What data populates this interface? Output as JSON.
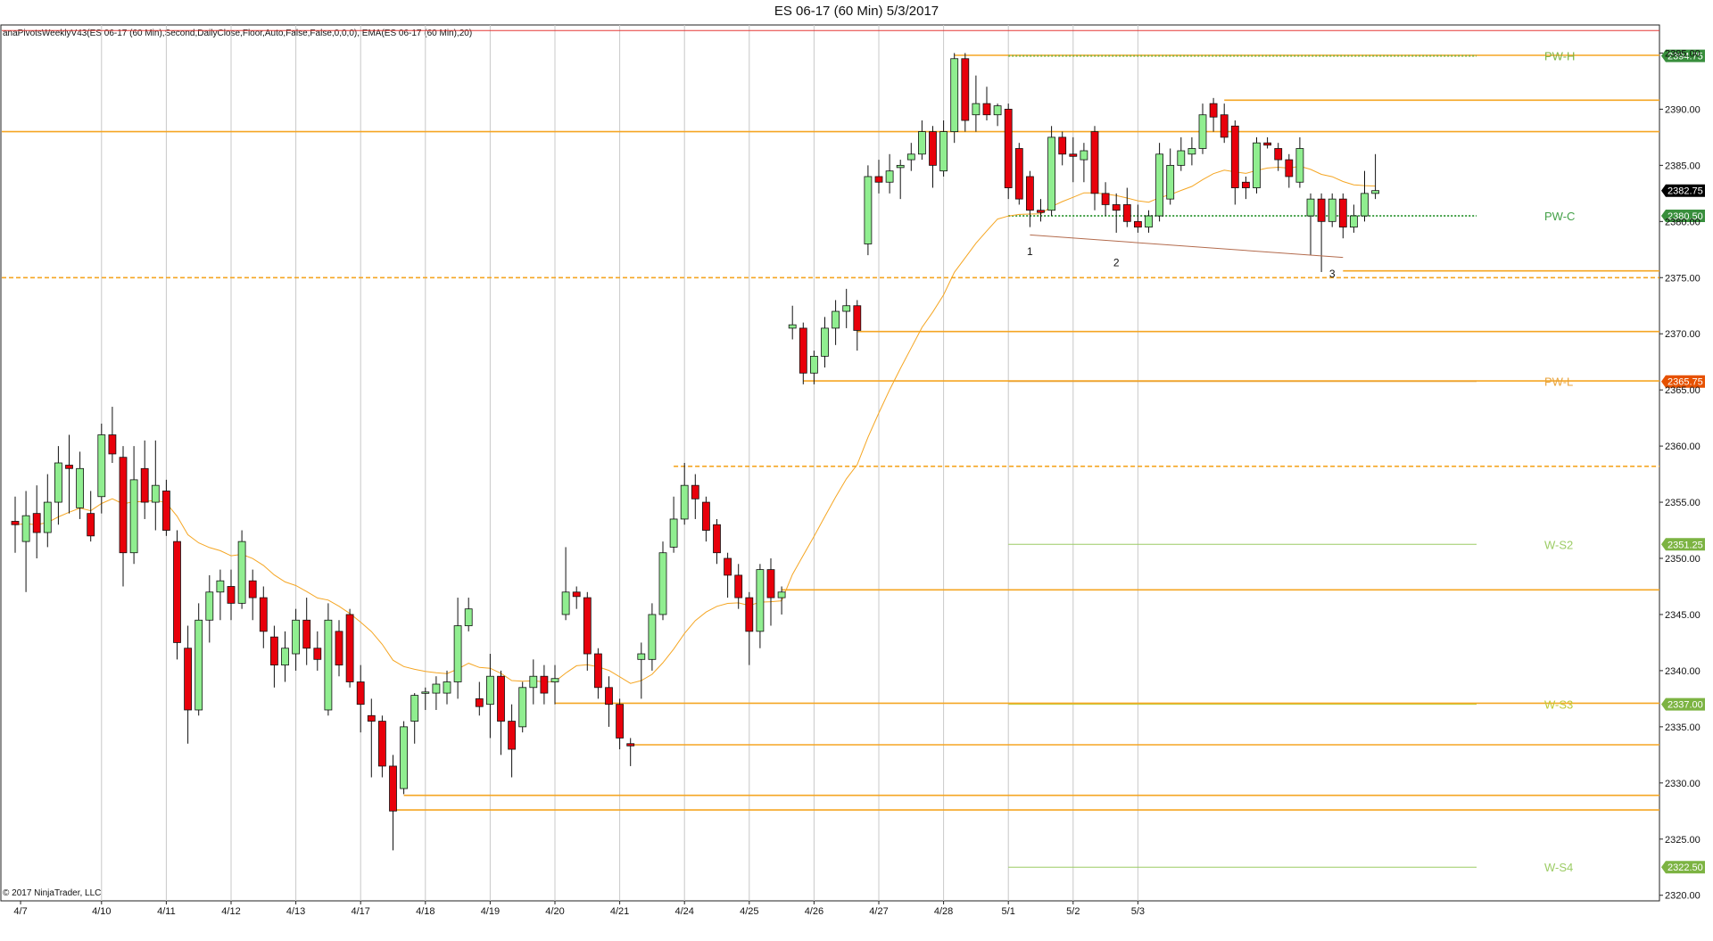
{
  "chart_data": {
    "type": "candlestick",
    "title": "ES 06-17 (60 Min)  5/3/2017",
    "indicator_label": "anaPivotsWeeklyV43(ES 06-17 (60 Min),Second,DailyClose,Floor,Auto,False,False,0,0,0), EMA(ES 06-17 (60 Min),20)",
    "copyright": "© 2017 NinjaTrader, LLC",
    "ylim": [
      2319.5,
      2397.5
    ],
    "y_ticks": [
      "2320.00",
      "2325.00",
      "2330.00",
      "2335.00",
      "2340.00",
      "2345.00",
      "2350.00",
      "2355.00",
      "2360.00",
      "2365.00",
      "2370.00",
      "2375.00",
      "2380.00",
      "2385.00",
      "2390.00",
      "2395.00"
    ],
    "x_day_labels": [
      "4/7",
      "4/10",
      "4/11",
      "4/12",
      "4/13",
      "4/17",
      "4/18",
      "4/19",
      "4/20",
      "4/21",
      "4/24",
      "4/25",
      "4/26",
      "4/27",
      "4/28",
      "5/1",
      "5/2",
      "5/3"
    ],
    "x_day_bar_index": [
      0.5,
      8,
      14,
      20,
      26,
      32,
      38,
      44,
      50,
      56,
      62,
      68,
      74,
      80,
      86,
      92,
      98,
      104
    ],
    "candles": [
      {
        "o": 2353.3,
        "h": 2355.5,
        "l": 2350.5,
        "c": 2353.0
      },
      {
        "o": 2351.5,
        "h": 2356.0,
        "l": 2347.0,
        "c": 2353.8
      },
      {
        "o": 2354.0,
        "h": 2356.5,
        "l": 2350.0,
        "c": 2352.3
      },
      {
        "o": 2352.3,
        "h": 2357.5,
        "l": 2351.0,
        "c": 2355.0
      },
      {
        "o": 2355.0,
        "h": 2360.0,
        "l": 2353.0,
        "c": 2358.5
      },
      {
        "o": 2358.3,
        "h": 2361.0,
        "l": 2354.0,
        "c": 2358.0
      },
      {
        "o": 2354.5,
        "h": 2359.5,
        "l": 2353.5,
        "c": 2358.0
      },
      {
        "o": 2354.0,
        "h": 2356.0,
        "l": 2351.5,
        "c": 2352.0
      },
      {
        "o": 2355.5,
        "h": 2362.0,
        "l": 2354.0,
        "c": 2361.0
      },
      {
        "o": 2361.0,
        "h": 2363.5,
        "l": 2358.5,
        "c": 2359.3
      },
      {
        "o": 2359.0,
        "h": 2360.0,
        "l": 2347.5,
        "c": 2350.5
      },
      {
        "o": 2350.5,
        "h": 2360.0,
        "l": 2349.5,
        "c": 2357.0
      },
      {
        "o": 2358.0,
        "h": 2360.5,
        "l": 2353.5,
        "c": 2355.0
      },
      {
        "o": 2355.0,
        "h": 2360.5,
        "l": 2352.5,
        "c": 2356.5
      },
      {
        "o": 2356.0,
        "h": 2357.0,
        "l": 2352.0,
        "c": 2352.5
      },
      {
        "o": 2351.5,
        "h": 2352.5,
        "l": 2341.0,
        "c": 2342.5
      },
      {
        "o": 2342.0,
        "h": 2344.0,
        "l": 2333.5,
        "c": 2336.5
      },
      {
        "o": 2336.5,
        "h": 2346.0,
        "l": 2336.0,
        "c": 2344.5
      },
      {
        "o": 2344.5,
        "h": 2348.5,
        "l": 2342.5,
        "c": 2347.0
      },
      {
        "o": 2347.0,
        "h": 2349.0,
        "l": 2344.5,
        "c": 2348.0
      },
      {
        "o": 2347.5,
        "h": 2349.0,
        "l": 2344.5,
        "c": 2346.0
      },
      {
        "o": 2346.0,
        "h": 2352.5,
        "l": 2345.5,
        "c": 2351.5
      },
      {
        "o": 2348.0,
        "h": 2349.0,
        "l": 2344.5,
        "c": 2346.5
      },
      {
        "o": 2346.5,
        "h": 2347.5,
        "l": 2342.0,
        "c": 2343.5
      },
      {
        "o": 2343.0,
        "h": 2344.0,
        "l": 2338.5,
        "c": 2340.5
      },
      {
        "o": 2340.5,
        "h": 2343.5,
        "l": 2339.0,
        "c": 2342.0
      },
      {
        "o": 2341.5,
        "h": 2345.5,
        "l": 2340.0,
        "c": 2344.5
      },
      {
        "o": 2344.5,
        "h": 2346.5,
        "l": 2340.5,
        "c": 2342.0
      },
      {
        "o": 2342.0,
        "h": 2343.5,
        "l": 2340.0,
        "c": 2341.0
      },
      {
        "o": 2336.5,
        "h": 2346.0,
        "l": 2336.0,
        "c": 2344.5
      },
      {
        "o": 2343.5,
        "h": 2344.5,
        "l": 2339.5,
        "c": 2340.5
      },
      {
        "o": 2345.0,
        "h": 2345.5,
        "l": 2338.5,
        "c": 2339.0
      },
      {
        "o": 2339.0,
        "h": 2340.5,
        "l": 2334.5,
        "c": 2337.0
      },
      {
        "o": 2336.0,
        "h": 2337.5,
        "l": 2330.5,
        "c": 2335.5
      },
      {
        "o": 2335.5,
        "h": 2336.0,
        "l": 2330.5,
        "c": 2331.5
      },
      {
        "o": 2331.5,
        "h": 2332.5,
        "l": 2324.0,
        "c": 2327.5
      },
      {
        "o": 2329.5,
        "h": 2335.5,
        "l": 2329.0,
        "c": 2335.0
      },
      {
        "o": 2335.5,
        "h": 2338.0,
        "l": 2333.5,
        "c": 2337.8
      },
      {
        "o": 2338.0,
        "h": 2338.5,
        "l": 2336.5,
        "c": 2338.1
      },
      {
        "o": 2338.0,
        "h": 2339.5,
        "l": 2336.5,
        "c": 2338.8
      },
      {
        "o": 2338.0,
        "h": 2340.0,
        "l": 2337.0,
        "c": 2339.0
      },
      {
        "o": 2339.0,
        "h": 2346.5,
        "l": 2337.5,
        "c": 2344.0
      },
      {
        "o": 2344.0,
        "h": 2346.5,
        "l": 2343.5,
        "c": 2345.5
      },
      {
        "o": 2337.5,
        "h": 2339.0,
        "l": 2336.0,
        "c": 2336.8
      },
      {
        "o": 2337.0,
        "h": 2341.5,
        "l": 2334.0,
        "c": 2339.5
      },
      {
        "o": 2339.5,
        "h": 2340.0,
        "l": 2332.5,
        "c": 2335.5
      },
      {
        "o": 2335.5,
        "h": 2337.0,
        "l": 2330.5,
        "c": 2333.0
      },
      {
        "o": 2335.0,
        "h": 2339.0,
        "l": 2334.5,
        "c": 2338.5
      },
      {
        "o": 2338.5,
        "h": 2341.0,
        "l": 2337.0,
        "c": 2339.5
      },
      {
        "o": 2339.5,
        "h": 2340.5,
        "l": 2337.0,
        "c": 2338.0
      },
      {
        "o": 2339.0,
        "h": 2340.5,
        "l": 2337.0,
        "c": 2339.3
      },
      {
        "o": 2345.0,
        "h": 2351.0,
        "l": 2344.5,
        "c": 2347.0
      },
      {
        "o": 2347.0,
        "h": 2347.5,
        "l": 2345.5,
        "c": 2346.6
      },
      {
        "o": 2346.5,
        "h": 2347.0,
        "l": 2340.0,
        "c": 2341.5
      },
      {
        "o": 2341.5,
        "h": 2342.0,
        "l": 2337.5,
        "c": 2338.5
      },
      {
        "o": 2338.5,
        "h": 2339.5,
        "l": 2335.0,
        "c": 2337.0
      },
      {
        "o": 2337.0,
        "h": 2337.5,
        "l": 2333.0,
        "c": 2334.0
      },
      {
        "o": 2333.5,
        "h": 2334.0,
        "l": 2331.5,
        "c": 2333.3
      },
      {
        "o": 2341.0,
        "h": 2342.5,
        "l": 2337.5,
        "c": 2341.5
      },
      {
        "o": 2341.0,
        "h": 2346.0,
        "l": 2340.0,
        "c": 2345.0
      },
      {
        "o": 2345.0,
        "h": 2351.5,
        "l": 2344.5,
        "c": 2350.5
      },
      {
        "o": 2351.0,
        "h": 2355.5,
        "l": 2350.5,
        "c": 2353.5
      },
      {
        "o": 2353.5,
        "h": 2358.5,
        "l": 2353.0,
        "c": 2356.5
      },
      {
        "o": 2356.5,
        "h": 2357.5,
        "l": 2353.5,
        "c": 2355.3
      },
      {
        "o": 2355.0,
        "h": 2355.5,
        "l": 2351.5,
        "c": 2352.5
      },
      {
        "o": 2353.0,
        "h": 2353.5,
        "l": 2349.5,
        "c": 2350.5
      },
      {
        "o": 2350.0,
        "h": 2350.5,
        "l": 2346.5,
        "c": 2348.5
      },
      {
        "o": 2348.5,
        "h": 2349.5,
        "l": 2345.5,
        "c": 2346.5
      },
      {
        "o": 2346.5,
        "h": 2347.0,
        "l": 2340.5,
        "c": 2343.5
      },
      {
        "o": 2343.5,
        "h": 2349.5,
        "l": 2342.0,
        "c": 2349.0
      },
      {
        "o": 2349.0,
        "h": 2350.0,
        "l": 2344.0,
        "c": 2346.5
      },
      {
        "o": 2346.5,
        "h": 2347.5,
        "l": 2345.0,
        "c": 2347.0
      },
      {
        "o": 2370.5,
        "h": 2372.5,
        "l": 2369.5,
        "c": 2370.8
      },
      {
        "o": 2370.5,
        "h": 2371.0,
        "l": 2365.5,
        "c": 2366.5
      },
      {
        "o": 2366.5,
        "h": 2368.5,
        "l": 2365.5,
        "c": 2368.0
      },
      {
        "o": 2368.0,
        "h": 2371.5,
        "l": 2367.0,
        "c": 2370.5
      },
      {
        "o": 2370.5,
        "h": 2373.0,
        "l": 2369.0,
        "c": 2372.0
      },
      {
        "o": 2372.0,
        "h": 2374.0,
        "l": 2370.5,
        "c": 2372.5
      },
      {
        "o": 2372.5,
        "h": 2373.0,
        "l": 2368.5,
        "c": 2370.3
      },
      {
        "o": 2378.0,
        "h": 2385.0,
        "l": 2377.0,
        "c": 2384.0
      },
      {
        "o": 2384.0,
        "h": 2385.5,
        "l": 2382.5,
        "c": 2383.5
      },
      {
        "o": 2383.5,
        "h": 2386.0,
        "l": 2382.5,
        "c": 2384.5
      },
      {
        "o": 2384.8,
        "h": 2385.5,
        "l": 2382.0,
        "c": 2385.0
      },
      {
        "o": 2385.5,
        "h": 2387.0,
        "l": 2384.5,
        "c": 2386.0
      },
      {
        "o": 2386.0,
        "h": 2389.0,
        "l": 2385.5,
        "c": 2388.0
      },
      {
        "o": 2388.0,
        "h": 2388.5,
        "l": 2383.0,
        "c": 2385.0
      },
      {
        "o": 2384.5,
        "h": 2389.0,
        "l": 2384.0,
        "c": 2388.0
      },
      {
        "o": 2388.0,
        "h": 2395.0,
        "l": 2387.0,
        "c": 2394.5
      },
      {
        "o": 2394.5,
        "h": 2395.0,
        "l": 2388.0,
        "c": 2389.0
      },
      {
        "o": 2389.5,
        "h": 2393.0,
        "l": 2388.0,
        "c": 2390.5
      },
      {
        "o": 2390.5,
        "h": 2392.0,
        "l": 2389.0,
        "c": 2389.5
      },
      {
        "o": 2389.5,
        "h": 2390.5,
        "l": 2388.5,
        "c": 2390.3
      },
      {
        "o": 2390.0,
        "h": 2390.5,
        "l": 2382.0,
        "c": 2383.0
      },
      {
        "o": 2386.5,
        "h": 2387.0,
        "l": 2381.5,
        "c": 2382.0
      },
      {
        "o": 2384.0,
        "h": 2384.5,
        "l": 2379.5,
        "c": 2381.0
      },
      {
        "o": 2381.0,
        "h": 2382.0,
        "l": 2380.0,
        "c": 2380.8
      },
      {
        "o": 2381.0,
        "h": 2388.5,
        "l": 2380.5,
        "c": 2387.5
      },
      {
        "o": 2387.5,
        "h": 2388.0,
        "l": 2385.0,
        "c": 2386.0
      },
      {
        "o": 2386.0,
        "h": 2387.5,
        "l": 2383.5,
        "c": 2385.8
      },
      {
        "o": 2385.5,
        "h": 2387.0,
        "l": 2383.5,
        "c": 2386.3
      },
      {
        "o": 2388.0,
        "h": 2388.5,
        "l": 2381.0,
        "c": 2382.5
      },
      {
        "o": 2382.5,
        "h": 2383.5,
        "l": 2380.5,
        "c": 2381.5
      },
      {
        "o": 2381.5,
        "h": 2382.5,
        "l": 2379.0,
        "c": 2381.0
      },
      {
        "o": 2381.5,
        "h": 2383.0,
        "l": 2379.5,
        "c": 2380.0
      },
      {
        "o": 2380.0,
        "h": 2381.5,
        "l": 2379.0,
        "c": 2379.5
      },
      {
        "o": 2379.5,
        "h": 2381.0,
        "l": 2379.0,
        "c": 2380.5
      },
      {
        "o": 2380.5,
        "h": 2387.0,
        "l": 2380.0,
        "c": 2386.0
      },
      {
        "o": 2382.0,
        "h": 2386.5,
        "l": 2381.5,
        "c": 2385.0
      },
      {
        "o": 2385.0,
        "h": 2387.5,
        "l": 2384.5,
        "c": 2386.3
      },
      {
        "o": 2386.0,
        "h": 2387.5,
        "l": 2385.0,
        "c": 2386.5
      },
      {
        "o": 2386.5,
        "h": 2390.5,
        "l": 2386.0,
        "c": 2389.5
      },
      {
        "o": 2390.5,
        "h": 2391.0,
        "l": 2388.0,
        "c": 2389.3
      },
      {
        "o": 2389.5,
        "h": 2390.5,
        "l": 2387.0,
        "c": 2387.5
      },
      {
        "o": 2388.5,
        "h": 2389.0,
        "l": 2381.5,
        "c": 2383.0
      },
      {
        "o": 2383.5,
        "h": 2384.0,
        "l": 2382.0,
        "c": 2383.0
      },
      {
        "o": 2383.0,
        "h": 2387.5,
        "l": 2382.5,
        "c": 2387.0
      },
      {
        "o": 2387.0,
        "h": 2387.5,
        "l": 2386.5,
        "c": 2386.8
      },
      {
        "o": 2386.5,
        "h": 2387.0,
        "l": 2384.5,
        "c": 2385.5
      },
      {
        "o": 2385.5,
        "h": 2386.0,
        "l": 2383.0,
        "c": 2384.0
      },
      {
        "o": 2383.5,
        "h": 2387.5,
        "l": 2383.0,
        "c": 2386.5
      },
      {
        "o": 2380.5,
        "h": 2382.5,
        "l": 2377.0,
        "c": 2382.0
      },
      {
        "o": 2382.0,
        "h": 2382.5,
        "l": 2375.5,
        "c": 2380.0
      },
      {
        "o": 2380.0,
        "h": 2382.5,
        "l": 2379.5,
        "c": 2382.0
      },
      {
        "o": 2382.0,
        "h": 2382.5,
        "l": 2378.5,
        "c": 2379.5
      },
      {
        "o": 2379.5,
        "h": 2381.5,
        "l": 2379.0,
        "c": 2380.5
      },
      {
        "o": 2380.5,
        "h": 2384.5,
        "l": 2380.0,
        "c": 2382.5
      },
      {
        "o": 2382.5,
        "h": 2386.0,
        "l": 2382.0,
        "c": 2382.75
      }
    ],
    "ema_period": 20,
    "horizontal_lines": [
      {
        "price": 2397.0,
        "color": "#e53935",
        "style": "solid",
        "start_bar": 0
      },
      {
        "price": 2388.0,
        "color": "#f5a623",
        "style": "solid",
        "start_bar": 0
      },
      {
        "price": 2375.0,
        "color": "#f5a623",
        "style": "dashed",
        "start_bar": 0
      },
      {
        "price": 2394.8,
        "color": "#f5a623",
        "style": "solid",
        "start_bar": 87
      },
      {
        "price": 2390.8,
        "color": "#f5a623",
        "style": "solid",
        "start_bar": 112
      },
      {
        "price": 2375.6,
        "color": "#f5a623",
        "style": "solid",
        "start_bar": 123
      },
      {
        "price": 2370.2,
        "color": "#f5a623",
        "style": "solid",
        "start_bar": 78
      },
      {
        "price": 2365.8,
        "color": "#f5a623",
        "style": "solid",
        "start_bar": 73
      },
      {
        "price": 2358.2,
        "color": "#f5a623",
        "style": "dashed",
        "start_bar": 61
      },
      {
        "price": 2347.2,
        "color": "#f5a623",
        "style": "solid",
        "start_bar": 71
      },
      {
        "price": 2337.1,
        "color": "#f5a623",
        "style": "solid",
        "start_bar": 50
      },
      {
        "price": 2333.4,
        "color": "#f5a623",
        "style": "solid",
        "start_bar": 57
      },
      {
        "price": 2328.9,
        "color": "#f5a623",
        "style": "solid",
        "start_bar": 36
      },
      {
        "price": 2327.6,
        "color": "#f5a623",
        "style": "solid",
        "start_bar": 35
      }
    ],
    "pivot_levels": [
      {
        "label": "PW-H",
        "price": 2394.75,
        "badge": "2394.75",
        "color": "#7cb342",
        "badge_color": "#388e3c",
        "line": "dotted"
      },
      {
        "label": "PW-C",
        "price": 2380.5,
        "badge": "2380.50",
        "color": "#43a047",
        "badge_color": "#388e3c",
        "line": "dotted"
      },
      {
        "label": "PW-L",
        "price": 2365.75,
        "badge": "2365.75",
        "color": "#e8a23a",
        "badge_color": "#e65100",
        "line": "solid"
      },
      {
        "label": "W-S2",
        "price": 2351.25,
        "badge": "2351.25",
        "color": "#9ccc65",
        "badge_color": "#7cb342",
        "line": "solid"
      },
      {
        "label": "W-S3",
        "price": 2337.0,
        "badge": "2337.00",
        "color": "#c0ca33",
        "badge_color": "#7cb342",
        "line": "solid"
      },
      {
        "label": "W-S4",
        "price": 2322.5,
        "badge": "2322.50",
        "color": "#9ccc65",
        "badge_color": "#7cb342",
        "line": "solid"
      }
    ],
    "last_price": {
      "price": 2382.75,
      "badge": "2382.75"
    },
    "wave_labels": [
      {
        "text": "1",
        "bar": 94,
        "price": 2377.8
      },
      {
        "text": "2",
        "bar": 102,
        "price": 2376.8
      },
      {
        "text": "3",
        "bar": 122,
        "price": 2375.8
      }
    ],
    "trendline": {
      "start_bar": 94,
      "start_price": 2378.8,
      "end_bar": 123,
      "end_price": 2376.8
    }
  },
  "colors": {
    "bull": "#90ee90",
    "bear": "#e8000b",
    "ema": "#f5a623",
    "grid": "#c8c8c8",
    "axis": "#222222"
  }
}
